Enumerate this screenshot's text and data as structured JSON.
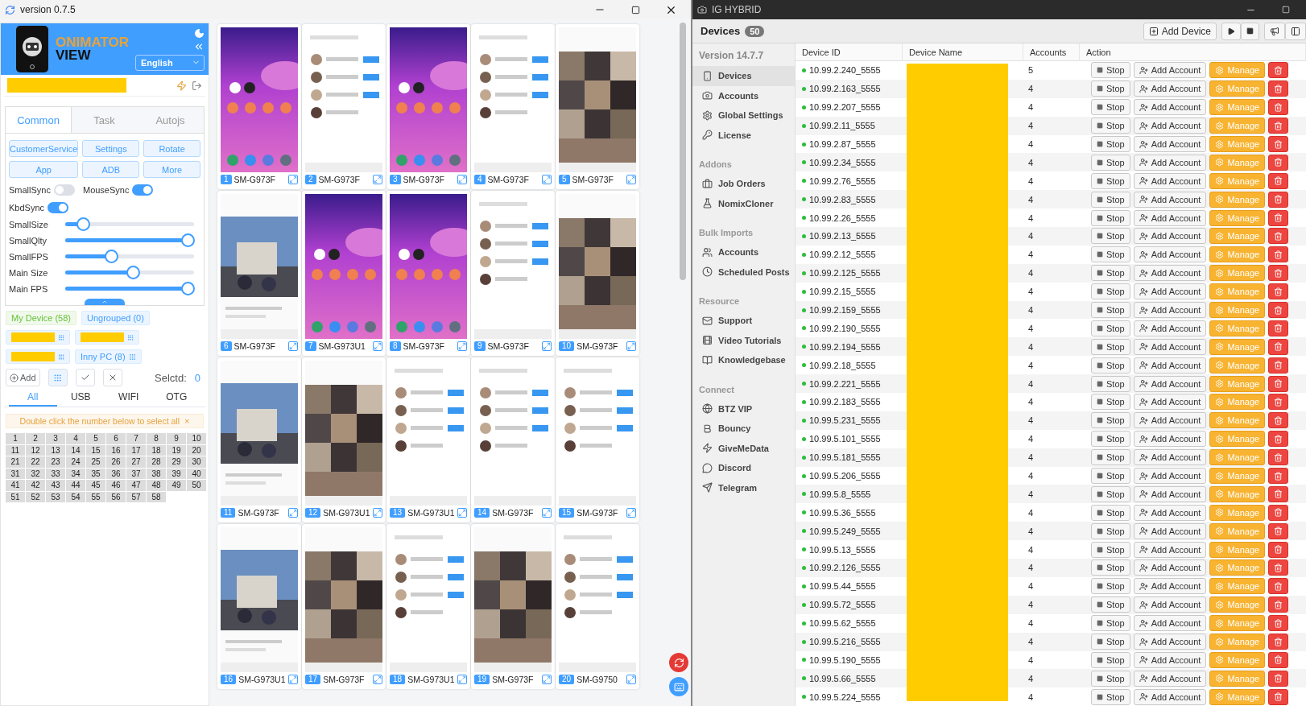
{
  "left_window": {
    "title": "version 0.7.5"
  },
  "app_header": {
    "logo_top": "ONIMATOR",
    "logo_bottom": "VIEW",
    "language": "English"
  },
  "control_tabs": [
    {
      "label": "Common",
      "selected": true
    },
    {
      "label": "Task",
      "selected": false
    },
    {
      "label": "Autojs",
      "selected": false
    }
  ],
  "control_buttons": [
    "CustomerService",
    "Settings",
    "Rotate",
    "App",
    "ADB",
    "More"
  ],
  "toggles": [
    {
      "label": "SmallSync",
      "on": false
    },
    {
      "label": "MouseSync",
      "on": true
    },
    {
      "label": "KbdSync",
      "on": true
    }
  ],
  "sliders": [
    {
      "label": "SmallSize",
      "level": 0.1
    },
    {
      "label": "SmallQlty",
      "level": 1
    },
    {
      "label": "SmallFPS",
      "level": 0.34
    },
    {
      "label": "Main Size",
      "level": 0.53
    },
    {
      "label": "Main FPS",
      "level": 1
    }
  ],
  "groups": [
    {
      "kind": "named",
      "label": "My Device (58)",
      "selected": true
    },
    {
      "kind": "named",
      "label": "Ungrouped (0)",
      "selected": false
    },
    {
      "kind": "redacted",
      "selected": false
    },
    {
      "kind": "redacted",
      "selected": false
    },
    {
      "kind": "redacted",
      "selected": false
    },
    {
      "kind": "named",
      "label": "Inny PC (8)",
      "selected": false
    }
  ],
  "selection": {
    "add": "Add",
    "label": "Selctd:",
    "count": "0"
  },
  "connection_tabs": [
    {
      "label": "All",
      "selected": true
    },
    {
      "label": "USB",
      "selected": false
    },
    {
      "label": "WIFI",
      "selected": false
    },
    {
      "label": "OTG",
      "selected": false
    }
  ],
  "hint": {
    "text": "Double click the number below to select all",
    "close": "×"
  },
  "numbers": [
    "1",
    "2",
    "3",
    "4",
    "5",
    "6",
    "7",
    "8",
    "9",
    "10",
    "11",
    "12",
    "13",
    "14",
    "15",
    "16",
    "17",
    "18",
    "19",
    "20",
    "21",
    "22",
    "23",
    "24",
    "25",
    "26",
    "27",
    "28",
    "29",
    "30",
    "31",
    "32",
    "33",
    "34",
    "35",
    "36",
    "37",
    "38",
    "39",
    "40",
    "41",
    "42",
    "43",
    "44",
    "45",
    "46",
    "47",
    "48",
    "49",
    "50",
    "51",
    "52",
    "53",
    "54",
    "55",
    "56",
    "57",
    "58"
  ],
  "phones": [
    {
      "number": "1",
      "model": "SM-G973F"
    },
    {
      "number": "2",
      "model": "SM-G973F"
    },
    {
      "number": "3",
      "model": "SM-G973F"
    },
    {
      "number": "4",
      "model": "SM-G973F"
    },
    {
      "number": "5",
      "model": "SM-G973F"
    },
    {
      "number": "6",
      "model": "SM-G973F"
    },
    {
      "number": "7",
      "model": "SM-G973U1"
    },
    {
      "number": "8",
      "model": "SM-G973F"
    },
    {
      "number": "9",
      "model": "SM-G973F"
    },
    {
      "number": "10",
      "model": "SM-G973F"
    },
    {
      "number": "11",
      "model": "SM-G973F"
    },
    {
      "number": "12",
      "model": "SM-G973U1"
    },
    {
      "number": "13",
      "model": "SM-G973U1"
    },
    {
      "number": "14",
      "model": "SM-G973F"
    },
    {
      "number": "15",
      "model": "SM-G973F"
    },
    {
      "number": "16",
      "model": "SM-G973U1"
    },
    {
      "number": "17",
      "model": "SM-G973F"
    },
    {
      "number": "18",
      "model": "SM-G973U1"
    },
    {
      "number": "19",
      "model": "SM-G973F"
    },
    {
      "number": "20",
      "model": "SM-G9750"
    }
  ],
  "right_window": {
    "title": "IG HYBRID"
  },
  "devices_header": {
    "title": "Devices",
    "count": "50",
    "add_button": "Add Device"
  },
  "sidebar": {
    "version": "Version 14.7.7",
    "sections": [
      {
        "items": [
          {
            "label": "Devices",
            "selected": true
          },
          {
            "label": "Accounts",
            "selected": false
          },
          {
            "label": "Global Settings",
            "selected": false
          },
          {
            "label": "License",
            "selected": false
          }
        ]
      },
      {
        "heading": "Addons",
        "items": [
          {
            "label": "Job Orders",
            "selected": false
          },
          {
            "label": "NomixCloner",
            "selected": false
          }
        ]
      },
      {
        "heading": "Bulk Imports",
        "items": [
          {
            "label": "Accounts",
            "selected": false
          },
          {
            "label": "Scheduled Posts",
            "selected": false
          }
        ]
      },
      {
        "heading": "Resource",
        "items": [
          {
            "label": "Support",
            "selected": false
          },
          {
            "label": "Video Tutorials",
            "selected": false
          },
          {
            "label": "Knowledgebase",
            "selected": false
          }
        ]
      },
      {
        "heading": "Connect",
        "items": [
          {
            "label": "BTZ VIP",
            "selected": false
          },
          {
            "label": "Bouncy",
            "selected": false
          },
          {
            "label": "GiveMeData",
            "selected": false
          },
          {
            "label": "Discord",
            "selected": false
          },
          {
            "label": "Telegram",
            "selected": false
          }
        ]
      }
    ]
  },
  "table": {
    "columns": [
      "Device ID",
      "Device Name",
      "Accounts",
      "Action"
    ],
    "rows": [
      {
        "device_id": "10.99.2.240_5555",
        "accounts": "5",
        "online": true,
        "actions": [
          "Stop",
          "Add Account",
          "Manage"
        ]
      },
      {
        "device_id": "10.99.2.163_5555",
        "accounts": "4",
        "online": true,
        "actions": [
          "Stop",
          "Add Account",
          "Manage"
        ]
      },
      {
        "device_id": "10.99.2.207_5555",
        "accounts": "4",
        "online": true,
        "actions": [
          "Stop",
          "Add Account",
          "Manage"
        ]
      },
      {
        "device_id": "10.99.2.11_5555",
        "accounts": "4",
        "online": true,
        "actions": [
          "Stop",
          "Add Account",
          "Manage"
        ]
      },
      {
        "device_id": "10.99.2.87_5555",
        "accounts": "4",
        "online": true,
        "actions": [
          "Stop",
          "Add Account",
          "Manage"
        ]
      },
      {
        "device_id": "10.99.2.34_5555",
        "accounts": "4",
        "online": true,
        "actions": [
          "Stop",
          "Add Account",
          "Manage"
        ]
      },
      {
        "device_id": "10.99.2.76_5555",
        "accounts": "4",
        "online": true,
        "actions": [
          "Stop",
          "Add Account",
          "Manage"
        ]
      },
      {
        "device_id": "10.99.2.83_5555",
        "accounts": "4",
        "online": true,
        "actions": [
          "Stop",
          "Add Account",
          "Manage"
        ]
      },
      {
        "device_id": "10.99.2.26_5555",
        "accounts": "4",
        "online": true,
        "actions": [
          "Stop",
          "Add Account",
          "Manage"
        ]
      },
      {
        "device_id": "10.99.2.13_5555",
        "accounts": "4",
        "online": true,
        "actions": [
          "Stop",
          "Add Account",
          "Manage"
        ]
      },
      {
        "device_id": "10.99.2.12_5555",
        "accounts": "4",
        "online": true,
        "actions": [
          "Stop",
          "Add Account",
          "Manage"
        ]
      },
      {
        "device_id": "10.99.2.125_5555",
        "accounts": "4",
        "online": true,
        "actions": [
          "Stop",
          "Add Account",
          "Manage"
        ]
      },
      {
        "device_id": "10.99.2.15_5555",
        "accounts": "4",
        "online": true,
        "actions": [
          "Stop",
          "Add Account",
          "Manage"
        ]
      },
      {
        "device_id": "10.99.2.159_5555",
        "accounts": "4",
        "online": true,
        "actions": [
          "Stop",
          "Add Account",
          "Manage"
        ]
      },
      {
        "device_id": "10.99.2.190_5555",
        "accounts": "4",
        "online": true,
        "actions": [
          "Stop",
          "Add Account",
          "Manage"
        ]
      },
      {
        "device_id": "10.99.2.194_5555",
        "accounts": "4",
        "online": true,
        "actions": [
          "Stop",
          "Add Account",
          "Manage"
        ]
      },
      {
        "device_id": "10.99.2.18_5555",
        "accounts": "4",
        "online": true,
        "actions": [
          "Stop",
          "Add Account",
          "Manage"
        ]
      },
      {
        "device_id": "10.99.2.221_5555",
        "accounts": "4",
        "online": true,
        "actions": [
          "Stop",
          "Add Account",
          "Manage"
        ]
      },
      {
        "device_id": "10.99.2.183_5555",
        "accounts": "4",
        "online": true,
        "actions": [
          "Stop",
          "Add Account",
          "Manage"
        ]
      },
      {
        "device_id": "10.99.5.231_5555",
        "accounts": "4",
        "online": true,
        "actions": [
          "Stop",
          "Add Account",
          "Manage"
        ]
      },
      {
        "device_id": "10.99.5.101_5555",
        "accounts": "4",
        "online": true,
        "actions": [
          "Stop",
          "Add Account",
          "Manage"
        ]
      },
      {
        "device_id": "10.99.5.181_5555",
        "accounts": "4",
        "online": true,
        "actions": [
          "Stop",
          "Add Account",
          "Manage"
        ]
      },
      {
        "device_id": "10.99.5.206_5555",
        "accounts": "4",
        "online": true,
        "actions": [
          "Stop",
          "Add Account",
          "Manage"
        ]
      },
      {
        "device_id": "10.99.5.8_5555",
        "accounts": "4",
        "online": true,
        "actions": [
          "Stop",
          "Add Account",
          "Manage"
        ]
      },
      {
        "device_id": "10.99.5.36_5555",
        "accounts": "4",
        "online": true,
        "actions": [
          "Stop",
          "Add Account",
          "Manage"
        ]
      },
      {
        "device_id": "10.99.5.249_5555",
        "accounts": "4",
        "online": true,
        "actions": [
          "Stop",
          "Add Account",
          "Manage"
        ]
      },
      {
        "device_id": "10.99.5.13_5555",
        "accounts": "4",
        "online": true,
        "actions": [
          "Stop",
          "Add Account",
          "Manage"
        ]
      },
      {
        "device_id": "10.99.2.126_5555",
        "accounts": "4",
        "online": true,
        "actions": [
          "Stop",
          "Add Account",
          "Manage"
        ]
      },
      {
        "device_id": "10.99.5.44_5555",
        "accounts": "4",
        "online": true,
        "actions": [
          "Stop",
          "Add Account",
          "Manage"
        ]
      },
      {
        "device_id": "10.99.5.72_5555",
        "accounts": "4",
        "online": true,
        "actions": [
          "Stop",
          "Add Account",
          "Manage"
        ]
      },
      {
        "device_id": "10.99.5.62_5555",
        "accounts": "4",
        "online": true,
        "actions": [
          "Stop",
          "Add Account",
          "Manage"
        ]
      },
      {
        "device_id": "10.99.5.216_5555",
        "accounts": "4",
        "online": true,
        "actions": [
          "Stop",
          "Add Account",
          "Manage"
        ]
      },
      {
        "device_id": "10.99.5.190_5555",
        "accounts": "4",
        "online": true,
        "actions": [
          "Stop",
          "Add Account",
          "Manage"
        ]
      },
      {
        "device_id": "10.99.5.66_5555",
        "accounts": "4",
        "online": true,
        "actions": [
          "Stop",
          "Add Account",
          "Manage"
        ]
      },
      {
        "device_id": "10.99.5.224_5555",
        "accounts": "4",
        "online": true,
        "actions": [
          "Stop",
          "Add Account",
          "Manage"
        ]
      }
    ]
  }
}
